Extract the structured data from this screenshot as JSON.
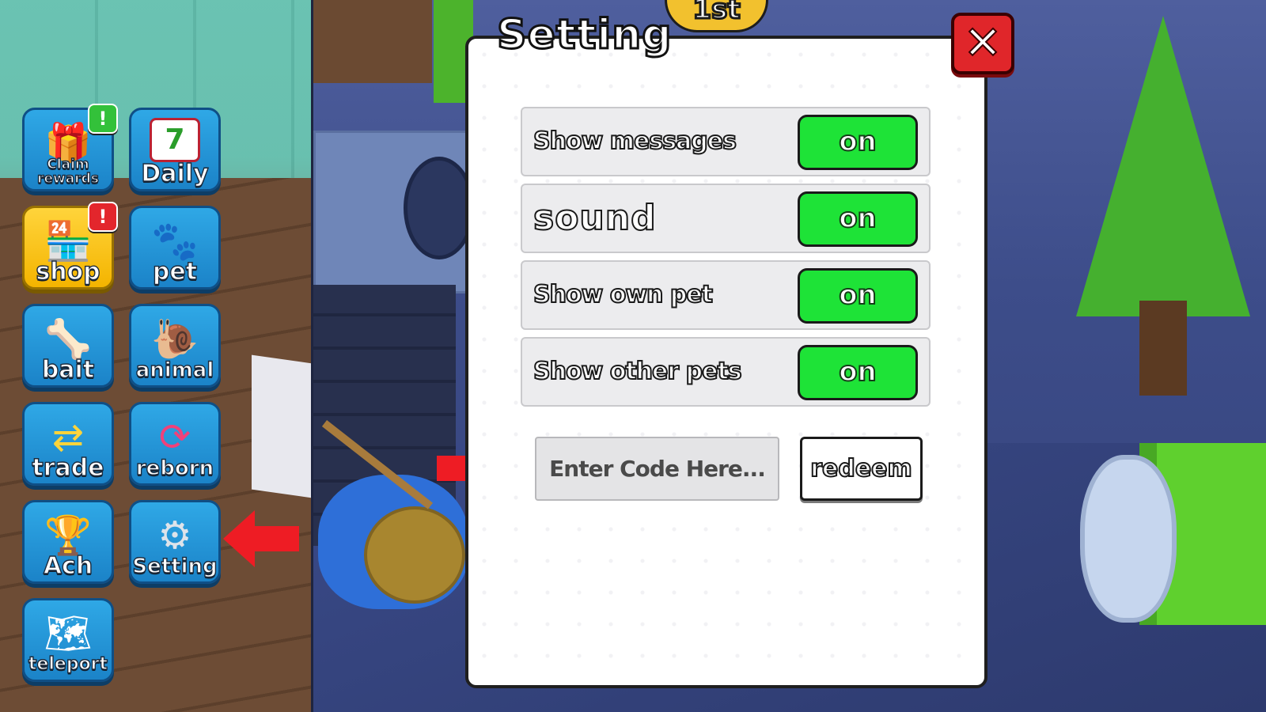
{
  "hud": {
    "rank_label": "1st"
  },
  "sidebar": {
    "buttons": [
      {
        "label": "Claim rewards",
        "icon": "gift-icon",
        "badge": "!",
        "badge_color": "#33c13a"
      },
      {
        "label": "Daily",
        "icon": "calendar-icon",
        "calendar_number": "7"
      },
      {
        "label": "shop",
        "icon": "store-icon",
        "badge": "!",
        "badge_color": "#e3262c"
      },
      {
        "label": "pet",
        "icon": "paw-icon"
      },
      {
        "label": "bait",
        "icon": "bone-icon"
      },
      {
        "label": "animal",
        "icon": "snail-icon"
      },
      {
        "label": "trade",
        "icon": "swap-arrows-icon"
      },
      {
        "label": "reborn",
        "icon": "rebirth-icon"
      },
      {
        "label": "Ach",
        "icon": "trophy-icon"
      },
      {
        "label": "Setting",
        "icon": "gear-icon"
      },
      {
        "label": "teleport",
        "icon": "map-icon"
      }
    ]
  },
  "settings": {
    "title": "Setting",
    "close_label": "✕",
    "rows": [
      {
        "label": "Show messages",
        "toggle": "on"
      },
      {
        "label": "sound",
        "toggle": "on"
      },
      {
        "label": "Show own pet",
        "toggle": "on"
      },
      {
        "label": "Show other pets",
        "toggle": "on"
      }
    ],
    "code": {
      "placeholder": "Enter Code Here...",
      "value": ""
    },
    "redeem_label": "redeem"
  },
  "colors": {
    "toggle_on": "#1ee337",
    "close_button": "#e0262a",
    "annotation_arrow": "#ee1c24",
    "sidebar_button": "#1b83c8"
  }
}
